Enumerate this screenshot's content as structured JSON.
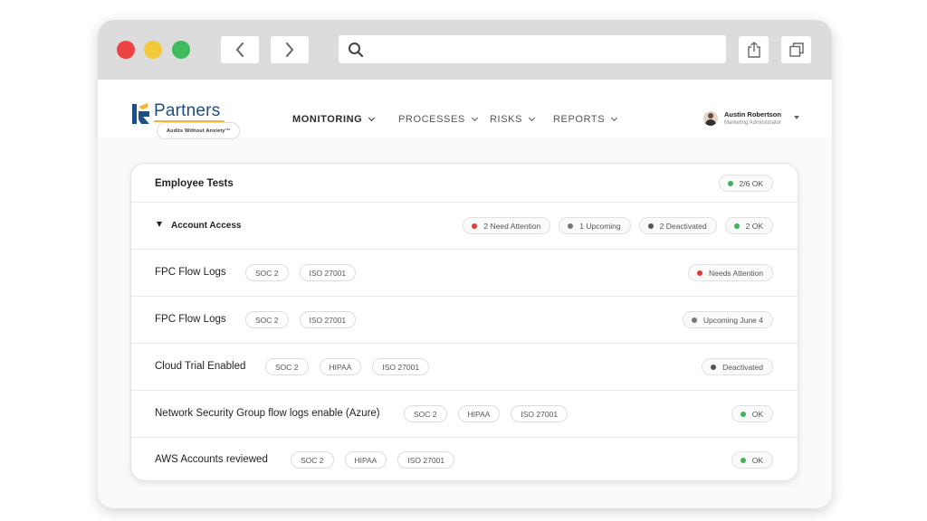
{
  "browser": {
    "url_value": "",
    "colors": {
      "close": "#ee4343",
      "minimize": "#f2c93b",
      "maximize": "#3fba5e"
    }
  },
  "logo": {
    "wordmark": "Partners",
    "tagline": "Audits Without Anxiety™"
  },
  "nav": {
    "items": [
      {
        "label": "MONITORING",
        "active": true
      },
      {
        "label": "PROCESSES",
        "active": false
      },
      {
        "label": "RISKS",
        "active": false
      },
      {
        "label": "REPORTS",
        "active": false
      }
    ]
  },
  "user": {
    "name": "Austin Robertson",
    "role": "Marketing Administrator"
  },
  "status_colors": {
    "attention": "#e53935",
    "upcoming": "#777777",
    "deactivated": "#555555",
    "ok": "#43b05c"
  },
  "panel": {
    "title": "Employee Tests",
    "summary": "2/6 OK",
    "group": {
      "title": "Account Access",
      "badges": [
        "2 Need Attention",
        "1 Upcoming",
        "2 Deactivated",
        "2 OK"
      ]
    },
    "tests": [
      {
        "name": "FPC Flow Logs",
        "tags": [
          "SOC 2",
          "ISO 27001"
        ],
        "status": "Needs Attention"
      },
      {
        "name": "FPC Flow Logs",
        "tags": [
          "SOC 2",
          "ISO 27001"
        ],
        "status": "Upcoming June 4"
      },
      {
        "name": "Cloud Trial Enabled",
        "tags": [
          "SOC 2",
          "HIPAA",
          "ISO 27001"
        ],
        "status": "Deactivated"
      },
      {
        "name": "Network Security Group flow logs enable (Azure)",
        "tags": [
          "SOC 2",
          "HIPAA",
          "ISO 27001"
        ],
        "status": "OK"
      },
      {
        "name": "AWS Accounts reviewed",
        "tags": [
          "SOC 2",
          "HIPAA",
          "ISO 27001"
        ],
        "status": "OK"
      }
    ]
  }
}
